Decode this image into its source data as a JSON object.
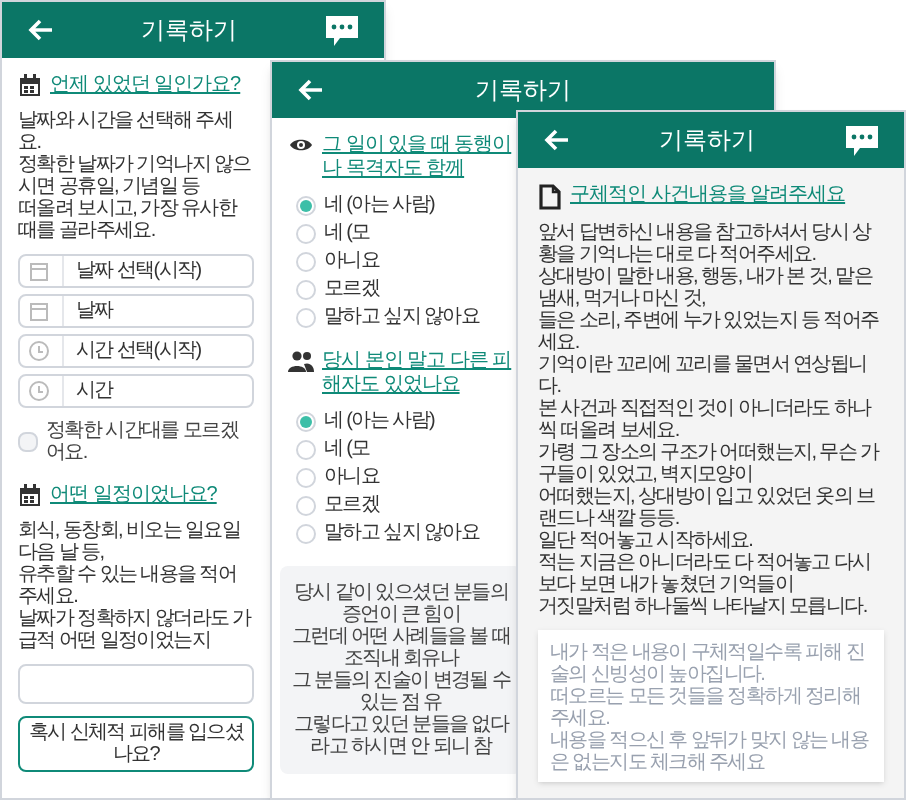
{
  "screens": [
    {
      "title": "기록하기",
      "sections": [
        {
          "kind": "datetime",
          "heading": "언제 있었던 일인가요?",
          "description": [
            "날짜와 시간을 선택해 주세요.",
            "정확한 날짜가 기억나지 않으시면 공휴일, 기념일 등",
            "떠올려 보시고, 가장 유사한 때를 골라주세요."
          ],
          "fields": [
            {
              "kind": "date",
              "label": "날짜 선택(시작)"
            },
            {
              "kind": "date",
              "label": "날짜"
            },
            {
              "kind": "time",
              "label": "시간 선택(시작)"
            },
            {
              "kind": "time",
              "label": "시간"
            }
          ],
          "checkbox": {
            "label": "정확한 시간대를 모르겠어요.",
            "checked": false
          }
        },
        {
          "kind": "text_entry",
          "heading": "어떤 일정이었나요?",
          "description": [
            "회식, 동창회, 비오는 일요일 다음 날 등,",
            "유추할 수 있는 내용을 적어주세요.",
            "날짜가 정확하지 않더라도 가급적 어떤 일정이었는지"
          ]
        }
      ],
      "button": "혹시 신체적 피해를 입으셨나요?"
    },
    {
      "title": "기록하기",
      "sections": [
        {
          "kind": "radios",
          "heading": "그 일이 있을 때 동행이나 목격자도 함께",
          "options": [
            {
              "label": "네 (아는 사람)",
              "selected": true
            },
            {
              "label": "네 (모",
              "selected": false
            },
            {
              "label": "아니요",
              "selected": false
            },
            {
              "label": "모르겠",
              "selected": false
            },
            {
              "label": "말하고 싶지 않아요",
              "selected": false
            }
          ]
        },
        {
          "kind": "radios",
          "heading": "당시 본인 말고 다른 피해자도 있었나요",
          "options": [
            {
              "label": "네 (아는 사람)",
              "selected": true
            },
            {
              "label": "네 (모",
              "selected": false
            },
            {
              "label": "아니요",
              "selected": false
            },
            {
              "label": "모르겠",
              "selected": false
            },
            {
              "label": "말하고 싶지 않아요",
              "selected": false
            }
          ]
        },
        {
          "kind": "note",
          "lines": [
            "당시 같이 있으셨던 분들의 증언이 큰 힘이",
            "그런데 어떤 사례들을 볼 때 조직내 회유나",
            "그 분들의 진술이 변경될 수 있는 점 유",
            "그렇다고 있던 분들을 없다라고 하시면 안 되니 참"
          ]
        }
      ]
    },
    {
      "title": "기록하기",
      "sections": [
        {
          "kind": "free_text",
          "heading": "구체적인 사건내용을 알려주세요",
          "description": [
            "앞서 답변하신 내용을 참고하셔서 당시 상황을 기억나는 대로 다 적어주세요.",
            "상대방이 말한 내용, 행동, 내가 본 것, 맡은 냄새, 먹거나 마신 것,",
            "들은 소리, 주변에 누가 있었는지 등 적어주세요.",
            "기억이란 꼬리에 꼬리를 물면서 연상됩니다.",
            "본 사건과 직접적인 것이 아니더라도 하나씩 떠올려 보세요.",
            "가령 그 장소의 구조가 어떠했는지, 무슨 가구들이 있었고, 벽지모양이",
            "어떠했는지, 상대방이 입고 있었던 옷의 브랜드나 색깔 등등.",
            "일단 적어놓고 시작하세요.",
            "적는 지금은 아니더라도 다 적어놓고 다시 보다 보면 내가 놓쳤던 기억들이",
            "거짓말처럼 하나둘씩 나타날지 모릅니다."
          ],
          "placeholder": [
            "내가 적은 내용이 구체적일수록 피해 진술의 신빙성이 높아집니다.",
            "떠오르는 모든 것들을 정확하게 정리해 주세요.",
            "내용을 적으신 후 앞뒤가 맞지 않는 내용은 없는지도 체크해 주세요"
          ]
        }
      ]
    }
  ]
}
